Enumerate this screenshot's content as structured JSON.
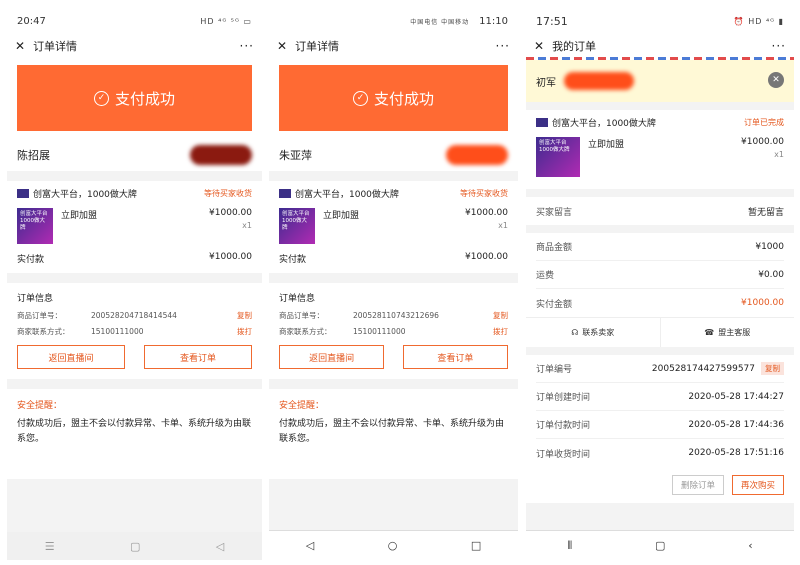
{
  "phone1": {
    "time": "20:47",
    "status_icons": "HD ⁴ᴳ ⁵ᴳ ▭",
    "title": "订单详情",
    "banner": "支付成功",
    "person": "陈招展",
    "shop": "创富大平台，1000做大牌",
    "order_status": "等待买家收货",
    "product": "立即加盟",
    "thumb_text": "创富大平台 1000做大牌",
    "price": "¥1000.00",
    "qty": "x1",
    "paid_label": "实付款",
    "paid_value": "¥1000.00",
    "info_title": "订单信息",
    "order_no_label": "商品订单号：",
    "order_no": "200528204718414544",
    "copy": "复制",
    "contact_label": "商家联系方式：",
    "contact": "15100111000",
    "call": "拨打",
    "back_btn": "返回直播间",
    "view_btn": "查看订单",
    "safety_title": "安全提醒：",
    "safety_text": "付款成功后，盟主不会以付款异常、卡单、系统升级为由联系您。"
  },
  "phone2": {
    "time": "11:10",
    "carrier": "中国电信 中国移动",
    "title": "订单详情",
    "banner": "支付成功",
    "person": "朱亚萍",
    "shop": "创富大平台，1000做大牌",
    "order_status": "等待买家收货",
    "product": "立即加盟",
    "thumb_text": "创富大平台 1000做大牌",
    "price": "¥1000.00",
    "qty": "x1",
    "paid_label": "实付款",
    "paid_value": "¥1000.00",
    "info_title": "订单信息",
    "order_no_label": "商品订单号：",
    "order_no": "200528110743212696",
    "copy": "复制",
    "contact_label": "商家联系方式：",
    "contact": "15100111000",
    "call": "拨打",
    "back_btn": "返回直播间",
    "view_btn": "查看订单",
    "safety_title": "安全提醒：",
    "safety_text": "付款成功后，盟主不会以付款异常、卡单、系统升级为由联系您。"
  },
  "phone3": {
    "time": "17:51",
    "title": "我的订单",
    "notice_name": "初军",
    "shop": "创富大平台，1000做大牌",
    "order_status": "订单已完成",
    "product": "立即加盟",
    "thumb_text": "创富大平台 1000做大牌",
    "price": "¥1000.00",
    "qty": "x1",
    "msg_label": "买家留言",
    "msg_value": "暂无留言",
    "goods_label": "商品金额",
    "goods_value": "¥1000",
    "ship_label": "运费",
    "ship_value": "¥0.00",
    "paid_label": "实付金额",
    "paid_value": "¥1000.00",
    "contact_seller": "联系卖家",
    "support": "盟主客服",
    "order_no_label": "订单编号",
    "order_no": "200528174427599577",
    "copy": "复制",
    "created_label": "订单创建时间",
    "created": "2020-05-28 17:44:27",
    "paid_time_label": "订单付款时间",
    "paid_time": "2020-05-28 17:44:36",
    "recv_label": "订单收货时间",
    "recv": "2020-05-28 17:51:16",
    "delete_btn": "删除订单",
    "rebuy_btn": "再次购买"
  },
  "colors": {
    "accent": "#ff6a33",
    "orange_text": "#e4571e"
  }
}
